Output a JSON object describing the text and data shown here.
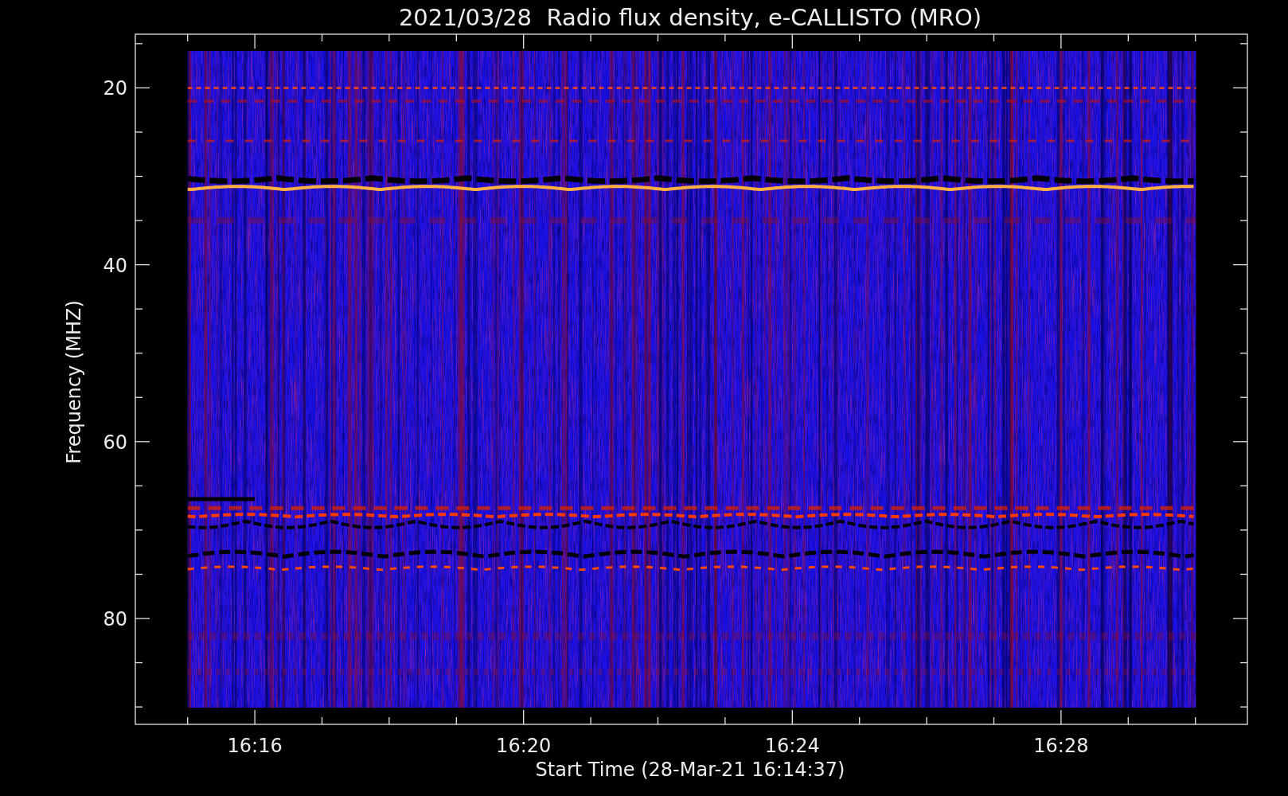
{
  "title": "2021/03/28  Radio flux density, e-CALLISTO (MRO)",
  "y_axis": {
    "label": "Frequency (MHZ)",
    "ticks": [
      "20",
      "40",
      "60",
      "80"
    ]
  },
  "x_axis": {
    "label": "Start Time (28-Mar-21 16:14:37)",
    "ticks": [
      "16:16",
      "16:20",
      "16:24",
      "16:28"
    ]
  }
}
